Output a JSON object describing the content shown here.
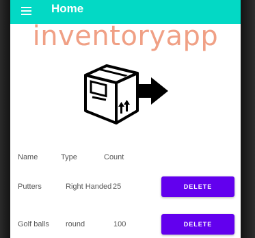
{
  "appbar": {
    "title": "Home",
    "menu_icon": "hamburger-menu-icon",
    "color": "#03d9c5"
  },
  "logo": {
    "text": "inventoryapp",
    "text_color": "#f0a085",
    "icon": "box-arrow-icon"
  },
  "table": {
    "headers": [
      "Name",
      "Type",
      "Count"
    ],
    "rows": [
      {
        "name": "Putters",
        "type": "Right Handed",
        "count": "25",
        "action": "DELETE"
      },
      {
        "name": "Golf balls",
        "type": "round",
        "count": "100",
        "action": "DELETE"
      }
    ]
  },
  "colors": {
    "button": "#6200ee"
  }
}
